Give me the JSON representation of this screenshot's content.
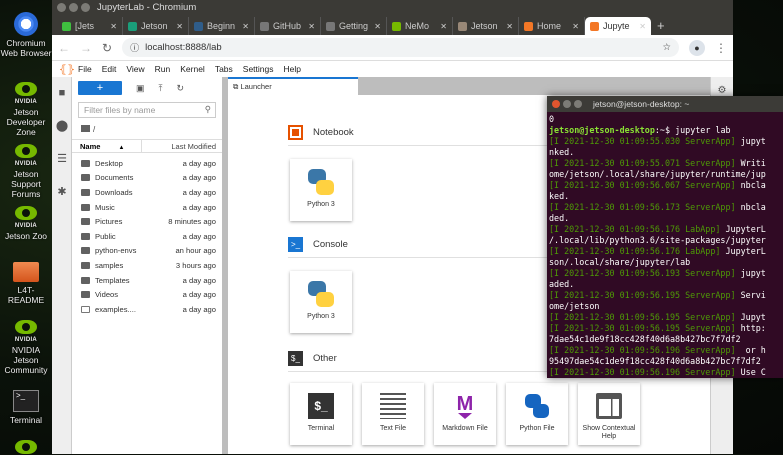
{
  "desktop": {
    "icons": [
      {
        "label": "Chromium Web Browser",
        "icon": "chromium-icon"
      },
      {
        "label": "Jetson Developer Zone",
        "icon": "nvidia-icon"
      },
      {
        "label": "Jetson Support Forums",
        "icon": "nvidia-icon"
      },
      {
        "label": "Jetson Zoo",
        "icon": "nvidia-icon"
      },
      {
        "label": "L4T-README",
        "icon": "folder-icon"
      },
      {
        "label": "NVIDIA Jetson Community",
        "icon": "nvidia-icon"
      },
      {
        "label": "Terminal",
        "icon": "terminal-icon"
      }
    ],
    "nvidia_text": "NVIDIA"
  },
  "browser": {
    "title": "JupyterLab - Chromium",
    "url": "localhost:8888/lab",
    "tabs": [
      {
        "label": "[Jets",
        "color": "#3fbf3f"
      },
      {
        "label": "Jetson",
        "color": "#1a9e7a"
      },
      {
        "label": "Beginn",
        "color": "#2f5d8a"
      },
      {
        "label": "GitHub",
        "color": "#777"
      },
      {
        "label": "Getting",
        "color": "#777"
      },
      {
        "label": "NeMo",
        "color": "#76b900"
      },
      {
        "label": "Jetson",
        "color": "#998877"
      },
      {
        "label": "Home",
        "color": "#f37726"
      },
      {
        "label": "Jupyte",
        "color": "#f37726",
        "active": true
      }
    ],
    "new_tab": "+"
  },
  "jupyter": {
    "menu": [
      "File",
      "Edit",
      "View",
      "Run",
      "Kernel",
      "Tabs",
      "Settings",
      "Help"
    ],
    "filebrowser": {
      "new_label": "+",
      "filter_placeholder": "Filter files by name",
      "path": "/",
      "col_name": "Name",
      "col_modified": "Last Modified",
      "files": [
        {
          "name": "Desktop",
          "modified": "a day ago",
          "type": "folder"
        },
        {
          "name": "Documents",
          "modified": "a day ago",
          "type": "folder"
        },
        {
          "name": "Downloads",
          "modified": "a day ago",
          "type": "folder"
        },
        {
          "name": "Music",
          "modified": "a day ago",
          "type": "folder"
        },
        {
          "name": "Pictures",
          "modified": "8 minutes ago",
          "type": "folder"
        },
        {
          "name": "Public",
          "modified": "a day ago",
          "type": "folder"
        },
        {
          "name": "python-envs",
          "modified": "an hour ago",
          "type": "folder"
        },
        {
          "name": "samples",
          "modified": "3 hours ago",
          "type": "folder"
        },
        {
          "name": "Templates",
          "modified": "a day ago",
          "type": "folder"
        },
        {
          "name": "Videos",
          "modified": "a day ago",
          "type": "folder"
        },
        {
          "name": "examples....",
          "modified": "a day ago",
          "type": "file"
        }
      ]
    },
    "launcher": {
      "tab": "Launcher",
      "notebook": {
        "title": "Notebook",
        "items": [
          "Python 3"
        ]
      },
      "console": {
        "title": "Console",
        "items": [
          "Python 3"
        ]
      },
      "other": {
        "title": "Other",
        "items": [
          "Terminal",
          "Text File",
          "Markdown File",
          "Python File",
          "Show Contextual Help"
        ]
      }
    }
  },
  "terminal": {
    "title": "jetson@jetson-desktop: ~",
    "first": "0",
    "prompt_user": "jetson@jetson-desktop",
    "prompt_path": ":~$ ",
    "command": "jupyter lab",
    "lines": [
      {
        "tag": "[I 2021-12-30 01:09:55.030 ServerApp]",
        "text": " jupyt"
      },
      {
        "tag": "",
        "text": "nked."
      },
      {
        "tag": "[I 2021-12-30 01:09:55.071 ServerApp]",
        "text": " Writi"
      },
      {
        "tag": "",
        "text": "ome/jetson/.local/share/jupyter/runtime/jup"
      },
      {
        "tag": "[I 2021-12-30 01:09:56.067 ServerApp]",
        "text": " nbcla"
      },
      {
        "tag": "",
        "text": "ked."
      },
      {
        "tag": "[I 2021-12-30 01:09:56.173 ServerApp]",
        "text": " nbcla"
      },
      {
        "tag": "",
        "text": "ded."
      },
      {
        "tag": "[I 2021-12-30 01:09:56.176 LabApp]",
        "text": " JupyterL"
      },
      {
        "tag": "",
        "text": "/.local/lib/python3.6/site-packages/jupyter"
      },
      {
        "tag": "[I 2021-12-30 01:09:56.176 LabApp]",
        "text": " JupyterL"
      },
      {
        "tag": "",
        "text": "son/.local/share/jupyter/lab"
      },
      {
        "tag": "[I 2021-12-30 01:09:56.193 ServerApp]",
        "text": " jupyt"
      },
      {
        "tag": "",
        "text": "aded."
      },
      {
        "tag": "[I 2021-12-30 01:09:56.195 ServerApp]",
        "text": " Servi"
      },
      {
        "tag": "",
        "text": "ome/jetson"
      },
      {
        "tag": "[I 2021-12-30 01:09:56.195 ServerApp]",
        "text": " Jupyt"
      },
      {
        "tag": "[I 2021-12-30 01:09:56.195 ServerApp]",
        "text": " http:"
      },
      {
        "tag": "",
        "text": "7dae54c1de9f18cc428f40d6a8b427bc7f7df2"
      },
      {
        "tag": "[I 2021-12-30 01:09:56.196 ServerApp]",
        "text": "  or h"
      },
      {
        "tag": "",
        "text": "95497dae54c1de9f18cc428f40d6a8b427bc7f7df2"
      },
      {
        "tag": "[I 2021-12-30 01:09:56.196 ServerApp]",
        "text": " Use C"
      }
    ]
  }
}
